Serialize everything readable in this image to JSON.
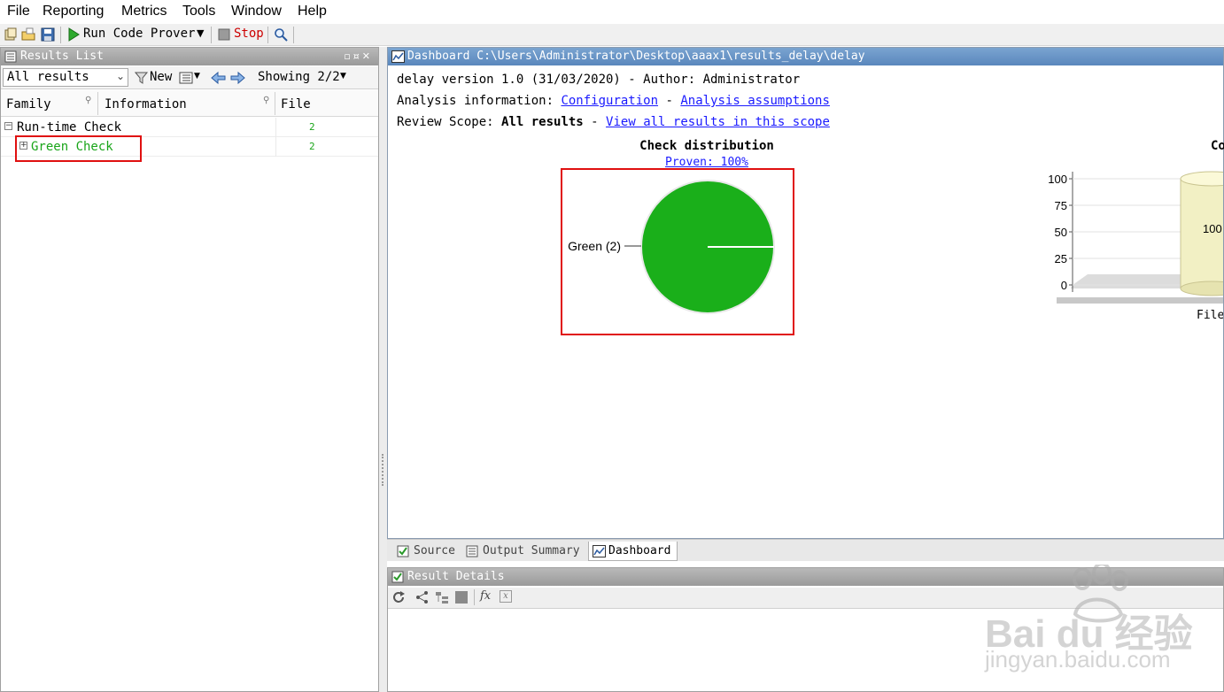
{
  "menu": [
    "File",
    "Reporting",
    "Metrics",
    "Tools",
    "Window",
    "Help"
  ],
  "toolbar": {
    "run_label": "Run Code Prover",
    "stop_label": "Stop",
    "run_color": "#2eaa2e",
    "stop_color": "#cc0000"
  },
  "results_list": {
    "title": "Results List",
    "filter_value": "All results",
    "new_label": "New",
    "showing": "Showing 2/2",
    "columns": [
      "Family",
      "Information",
      "File"
    ],
    "rows": [
      {
        "label": "Run-time Check",
        "count": "2",
        "toggle": "−",
        "color": "#000000"
      },
      {
        "label": "Green Check",
        "count": "2",
        "toggle": "+",
        "color": "#1aa51a"
      }
    ]
  },
  "dashboard": {
    "title": "Dashboard C:\\Users\\Administrator\\Desktop\\aaax1\\results_delay\\delay",
    "version_line": "delay version 1.0 (31/03/2020) - Author: Administrator",
    "analysis_prefix": "Analysis information:",
    "configuration_link": "Configuration",
    "dash_sep": "-",
    "assumptions_link": "Analysis assumptions",
    "scope_prefix": "Review Scope:",
    "scope_value": "All results",
    "scope_dash": "-",
    "scope_link": "View all results in this scope",
    "chart1": {
      "title": "Check distribution",
      "subtitle_link": "Proven: 100%",
      "slice_label": "Green (2)"
    },
    "chart2": {
      "title_partial": "Co",
      "bar_label": "100",
      "x_label": "File"
    }
  },
  "chart_data": [
    {
      "type": "pie",
      "title": "Check distribution",
      "subtitle": "Proven: 100%",
      "slices": [
        {
          "label": "Green (2)",
          "value": 2,
          "color": "#1aaf1a"
        }
      ]
    },
    {
      "type": "bar",
      "title": "Co",
      "categories": [
        "File"
      ],
      "values": [
        100
      ],
      "ylim": [
        0,
        100
      ],
      "yticks": [
        0,
        25,
        50,
        75,
        100
      ],
      "bar_label": "100",
      "bar_color": "#f2f0c4"
    }
  ],
  "bottom_tabs": [
    "Source",
    "Output Summary",
    "Dashboard"
  ],
  "result_details": {
    "title": "Result Details"
  },
  "watermark": {
    "brand": "Bai du 经验",
    "url": "jingyan.baidu.com"
  }
}
